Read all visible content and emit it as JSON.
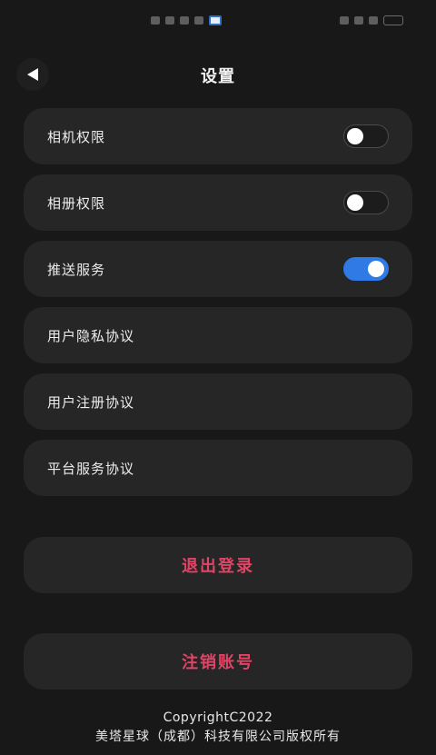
{
  "header": {
    "title": "设置"
  },
  "settings": {
    "items": [
      {
        "label": "相机权限",
        "toggle": false
      },
      {
        "label": "相册权限",
        "toggle": false
      },
      {
        "label": "推送服务",
        "toggle": true
      },
      {
        "label": "用户隐私协议"
      },
      {
        "label": "用户注册协议"
      },
      {
        "label": "平台服务协议"
      }
    ]
  },
  "actions": {
    "logout_label": "退出登录",
    "delete_account_label": "注销账号"
  },
  "footer": {
    "copyright": "CopyrightC2022",
    "company": "美塔星球（成都）科技有限公司版权所有"
  },
  "colors": {
    "background": "#181818",
    "card": "#262626",
    "accent_red": "#e04466",
    "toggle_on": "#2f7ae5"
  },
  "icons": {
    "back": "back-arrow-icon"
  }
}
